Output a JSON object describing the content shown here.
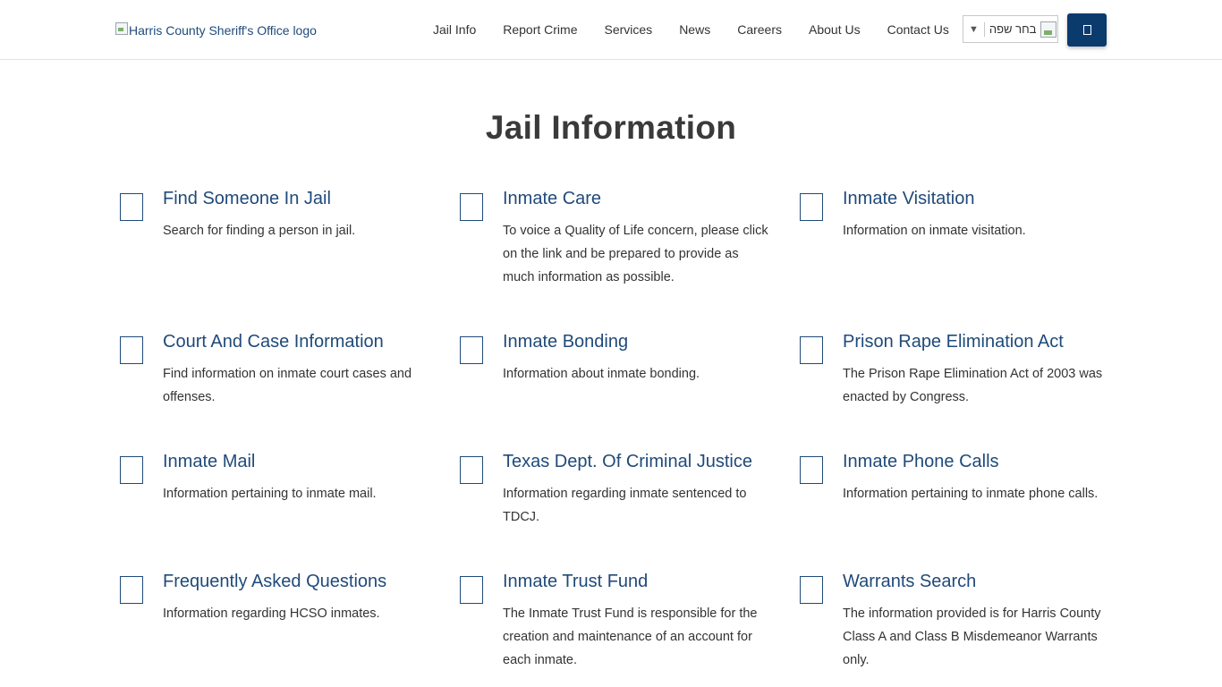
{
  "header": {
    "logo_alt": "Harris County Sheriff's Office logo",
    "nav": [
      {
        "label": "Jail Info"
      },
      {
        "label": "Report Crime"
      },
      {
        "label": "Services"
      },
      {
        "label": "News"
      },
      {
        "label": "Careers"
      },
      {
        "label": "About Us"
      },
      {
        "label": "Contact Us"
      }
    ],
    "language_select": {
      "arrow": "▼",
      "label": "בחר שפה"
    },
    "search_button_icon": "search-icon"
  },
  "page": {
    "title": "Jail Information"
  },
  "cards": [
    {
      "title": "Find Someone In Jail",
      "desc": "Search for finding a person in jail."
    },
    {
      "title": "Inmate Care",
      "desc": "To voice a Quality of Life concern, please click on the link and be prepared to provide as much information as possible."
    },
    {
      "title": "Inmate Visitation",
      "desc": "Information on inmate visitation."
    },
    {
      "title": "Court And Case Information",
      "desc": "Find information on inmate court cases and offenses."
    },
    {
      "title": "Inmate Bonding",
      "desc": "Information about inmate bonding."
    },
    {
      "title": "Prison Rape Elimination Act",
      "desc": "The Prison Rape Elimination Act of 2003 was enacted by Congress."
    },
    {
      "title": "Inmate Mail",
      "desc": "Information pertaining to inmate mail."
    },
    {
      "title": "Texas Dept. Of Criminal Justice",
      "desc": "Information regarding inmate sentenced to TDCJ."
    },
    {
      "title": "Inmate Phone Calls",
      "desc": "Information pertaining to inmate phone calls."
    },
    {
      "title": "Frequently Asked Questions",
      "desc": "Information regarding HCSO inmates."
    },
    {
      "title": "Inmate Trust Fund",
      "desc": "The Inmate Trust Fund is responsible for the creation and maintenance of an account for each inmate."
    },
    {
      "title": "Warrants Search",
      "desc": "The information provided is for Harris County Class A and Class B Misdemeanor Warrants only."
    }
  ],
  "colors": {
    "brand_blue": "#0b3a6d",
    "link_blue": "#1f4a7a"
  }
}
